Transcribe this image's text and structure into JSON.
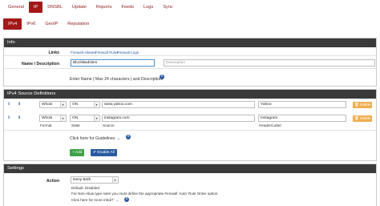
{
  "top_tabs": [
    "General",
    "IP",
    "DNSBL",
    "Update",
    "Reports",
    "Feeds",
    "Logs",
    "Sync"
  ],
  "sub_tabs": [
    "IPv4",
    "IPv6",
    "GeoIP",
    "Reputation"
  ],
  "info": {
    "header": "Info",
    "links_label": "Links",
    "links": [
      "Firewall Aliases",
      "Firewall Rules",
      "Firewall Logs"
    ],
    "name_label": "Name / Description",
    "name_value": "BlockBadsites",
    "description_placeholder": "Description",
    "name_help": "Enter Name | Max 24 characters | and Description."
  },
  "ipv4_sources": {
    "header": "IPv4 Source Definitions",
    "rows": [
      {
        "format": "Whois",
        "state": "ON",
        "source": "www.yahoo.com",
        "header": "Yahoo",
        "delete": "Delete"
      },
      {
        "format": "Whois",
        "state": "ON",
        "source": "instagram.com",
        "header": "Instagram",
        "delete": "Delete"
      }
    ],
    "col_labels": {
      "format": "Format",
      "state": "State",
      "source": "Source",
      "header": "Header/Label"
    },
    "guidelines": "Click here for Guidelines →",
    "add_label": "Add",
    "enable_all_label": "Enable All"
  },
  "settings": {
    "header": "Settings",
    "action_label": "Action",
    "action_value": "Deny Both",
    "default_text": "Default: Disabled",
    "help_text": "For Non-Alias type rules you must define the appropriate Firewall 'Auto' Rule Order option.",
    "info_link": "Click here for more infoâ†‘ →"
  },
  "colors": {
    "accent": "#a31818",
    "header_bg": "#3a3a3a",
    "delete": "#f0ad4e",
    "add": "#3ea346",
    "enable": "#2c5aa0"
  }
}
